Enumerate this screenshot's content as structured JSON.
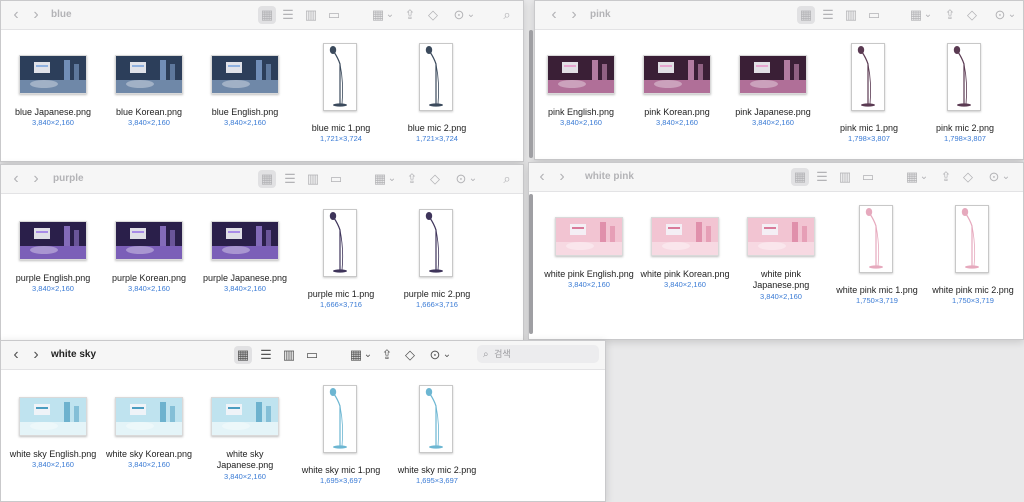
{
  "windows": [
    {
      "title": "blue",
      "theme": {
        "sky": "#2c3e5a",
        "floor": "#6f88a8",
        "accent": "#8fb1e0",
        "mic": "#3b4a5c"
      },
      "files": [
        {
          "name": "blue Japanese.png",
          "dims": "3,840×2,160",
          "kind": "stage"
        },
        {
          "name": "blue Korean.png",
          "dims": "3,840×2,160",
          "kind": "stage"
        },
        {
          "name": "blue English.png",
          "dims": "3,840×2,160",
          "kind": "stage"
        },
        {
          "name": "blue mic 1.png",
          "dims": "1,721×3,724",
          "kind": "mic"
        },
        {
          "name": "blue mic 2.png",
          "dims": "1,721×3,724",
          "kind": "mic"
        }
      ]
    },
    {
      "title": "pink",
      "theme": {
        "sky": "#3a1f36",
        "floor": "#b06f98",
        "accent": "#e6a4cf",
        "mic": "#5a3a52"
      },
      "files": [
        {
          "name": "pink English.png",
          "dims": "3,840×2,160",
          "kind": "stage"
        },
        {
          "name": "pink Korean.png",
          "dims": "3,840×2,160",
          "kind": "stage"
        },
        {
          "name": "pink Japanese.png",
          "dims": "3,840×2,160",
          "kind": "stage"
        },
        {
          "name": "pink mic 1.png",
          "dims": "1,798×3,807",
          "kind": "mic"
        },
        {
          "name": "pink mic 2.png",
          "dims": "1,798×3,807",
          "kind": "mic"
        }
      ]
    },
    {
      "title": "purple",
      "theme": {
        "sky": "#2a1f4a",
        "floor": "#7b5fb8",
        "accent": "#a98be8",
        "mic": "#3e345a"
      },
      "files": [
        {
          "name": "purple English.png",
          "dims": "3,840×2,160",
          "kind": "stage"
        },
        {
          "name": "purple Korean.png",
          "dims": "3,840×2,160",
          "kind": "stage"
        },
        {
          "name": "purple Japanese.png",
          "dims": "3,840×2,160",
          "kind": "stage"
        },
        {
          "name": "purple mic 1.png",
          "dims": "1,666×3,716",
          "kind": "mic"
        },
        {
          "name": "purple mic 2.png",
          "dims": "1,666×3,716",
          "kind": "mic"
        }
      ]
    },
    {
      "title": "white pink",
      "theme": {
        "sky": "#f2c4d2",
        "floor": "#f7d9e2",
        "accent": "#d97a9a",
        "mic": "#e6a9bd"
      },
      "files": [
        {
          "name": "white pink English.png",
          "dims": "3,840×2,160",
          "kind": "stage"
        },
        {
          "name": "white pink Korean.png",
          "dims": "3,840×2,160",
          "kind": "stage"
        },
        {
          "name": "white pink Japanese.png",
          "dims": "3,840×2,160",
          "kind": "stage"
        },
        {
          "name": "white pink mic 1.png",
          "dims": "1,750×3,719",
          "kind": "mic"
        },
        {
          "name": "white pink mic 2.png",
          "dims": "1,750×3,719",
          "kind": "mic"
        }
      ]
    },
    {
      "title": "white sky",
      "search_placeholder": "검색",
      "theme": {
        "sky": "#bfe3ef",
        "floor": "#e4f4f8",
        "accent": "#4a9cc0",
        "mic": "#6cb6d2"
      },
      "files": [
        {
          "name": "white sky English.png",
          "dims": "3,840×2,160",
          "kind": "stage"
        },
        {
          "name": "white sky Korean.png",
          "dims": "3,840×2,160",
          "kind": "stage"
        },
        {
          "name": "white sky Japanese.png",
          "dims": "3,840×2,160",
          "kind": "stage"
        },
        {
          "name": "white sky mic 1.png",
          "dims": "1,695×3,697",
          "kind": "mic"
        },
        {
          "name": "white sky mic 2.png",
          "dims": "1,695×3,697",
          "kind": "mic"
        }
      ]
    }
  ],
  "toolbar_icons": {
    "back": "‹",
    "forward": "›",
    "grid": "▦",
    "list": "☰",
    "columns": "▥",
    "gallery": "▭",
    "group": "▦",
    "chevron": "⌄",
    "share": "⇪",
    "tag": "◇",
    "more": "⊙",
    "search": "⌕"
  }
}
